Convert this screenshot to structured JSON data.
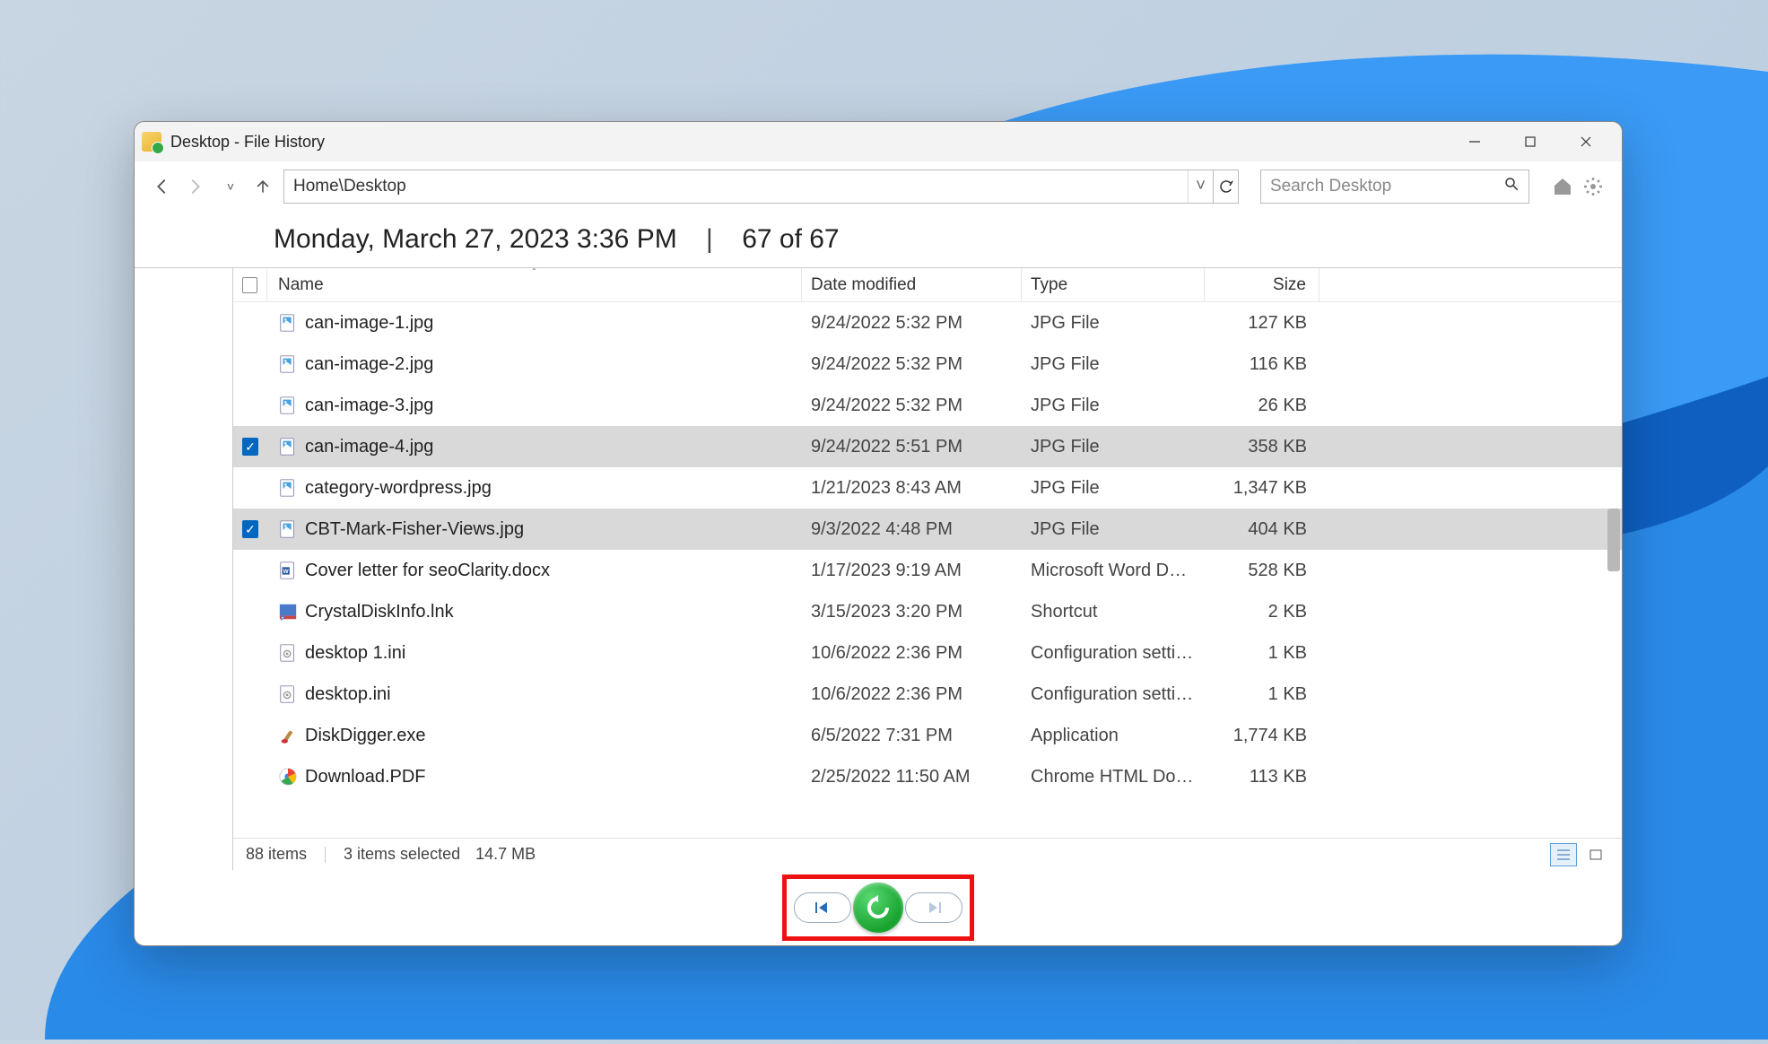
{
  "window": {
    "title": "Desktop - File History"
  },
  "path": "Home\\Desktop",
  "search_placeholder": "Search Desktop",
  "snapshot": {
    "date": "Monday, March 27, 2023 3:36 PM",
    "counter": "67 of 67"
  },
  "columns": {
    "name": "Name",
    "date": "Date modified",
    "type": "Type",
    "size": "Size"
  },
  "files": [
    {
      "name": "can-image-1.jpg",
      "date": "9/24/2022 5:32 PM",
      "type": "JPG File",
      "size": "127 KB",
      "icon": "jpg",
      "selected": false
    },
    {
      "name": "can-image-2.jpg",
      "date": "9/24/2022 5:32 PM",
      "type": "JPG File",
      "size": "116 KB",
      "icon": "jpg",
      "selected": false
    },
    {
      "name": "can-image-3.jpg",
      "date": "9/24/2022 5:32 PM",
      "type": "JPG File",
      "size": "26 KB",
      "icon": "jpg",
      "selected": false
    },
    {
      "name": "can-image-4.jpg",
      "date": "9/24/2022 5:51 PM",
      "type": "JPG File",
      "size": "358 KB",
      "icon": "jpg",
      "selected": true
    },
    {
      "name": "category-wordpress.jpg",
      "date": "1/21/2023 8:43 AM",
      "type": "JPG File",
      "size": "1,347 KB",
      "icon": "jpg",
      "selected": false
    },
    {
      "name": "CBT-Mark-Fisher-Views.jpg",
      "date": "9/3/2022 4:48 PM",
      "type": "JPG File",
      "size": "404 KB",
      "icon": "jpg",
      "selected": true
    },
    {
      "name": "Cover letter for seoClarity.docx",
      "date": "1/17/2023 9:19 AM",
      "type": "Microsoft Word Doc...",
      "size": "528 KB",
      "icon": "docx",
      "selected": false
    },
    {
      "name": "CrystalDiskInfo.lnk",
      "date": "3/15/2023 3:20 PM",
      "type": "Shortcut",
      "size": "2 KB",
      "icon": "lnk",
      "selected": false
    },
    {
      "name": "desktop 1.ini",
      "date": "10/6/2022 2:36 PM",
      "type": "Configuration settings",
      "size": "1 KB",
      "icon": "ini",
      "selected": false
    },
    {
      "name": "desktop.ini",
      "date": "10/6/2022 2:36 PM",
      "type": "Configuration settings",
      "size": "1 KB",
      "icon": "ini",
      "selected": false
    },
    {
      "name": "DiskDigger.exe",
      "date": "6/5/2022 7:31 PM",
      "type": "Application",
      "size": "1,774 KB",
      "icon": "exe",
      "selected": false
    },
    {
      "name": "Download.PDF",
      "date": "2/25/2022 11:50 AM",
      "type": "Chrome HTML Docu...",
      "size": "113 KB",
      "icon": "pdf",
      "selected": false
    }
  ],
  "status": {
    "items": "88 items",
    "selection": "3 items selected",
    "size": "14.7 MB"
  }
}
